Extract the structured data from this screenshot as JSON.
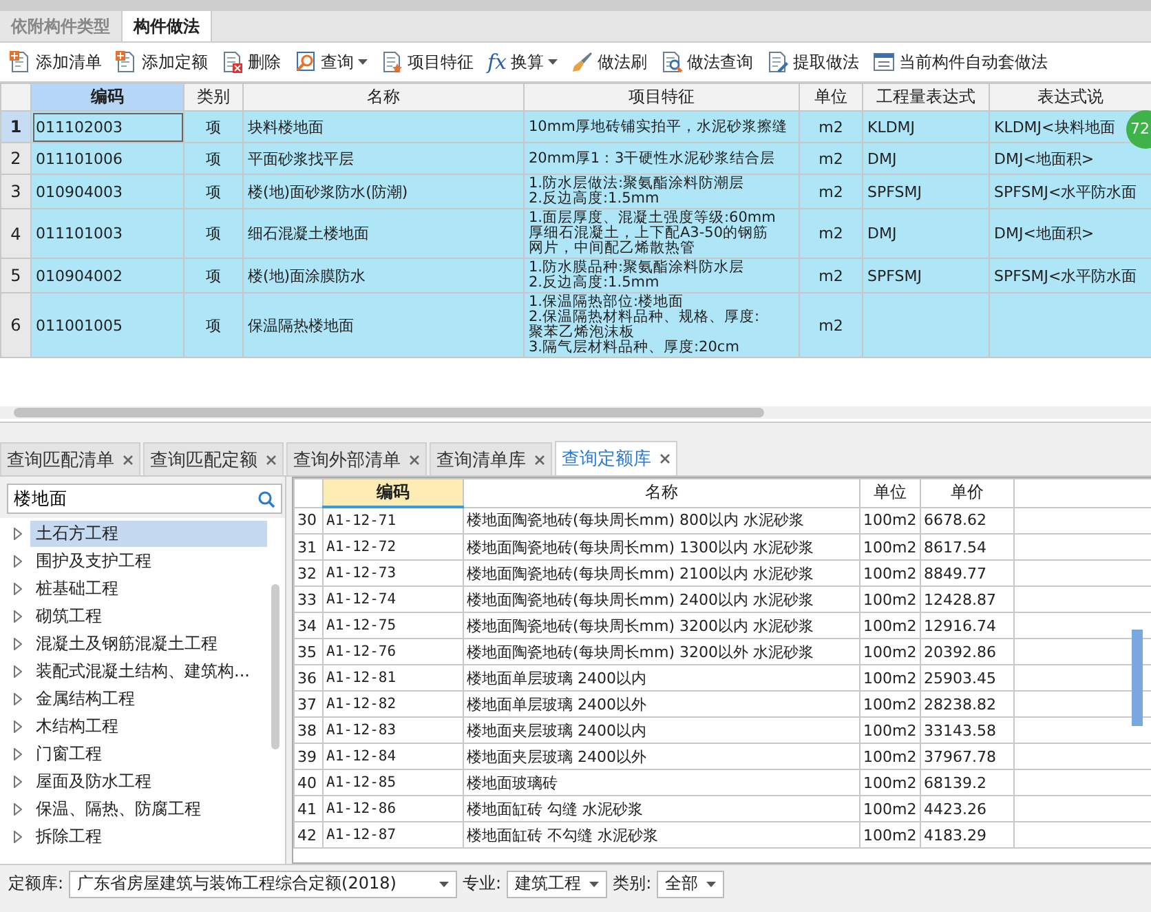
{
  "top_tabs": [
    {
      "label": "依附构件类型",
      "selected": false
    },
    {
      "label": "构件做法",
      "selected": true
    }
  ],
  "toolbar": [
    {
      "label": "添加清单",
      "dropdown": false
    },
    {
      "label": "添加定额",
      "dropdown": false
    },
    {
      "label": "删除",
      "dropdown": false
    },
    {
      "label": "查询",
      "dropdown": true
    },
    {
      "label": "项目特征",
      "dropdown": false
    },
    {
      "label": "换算",
      "dropdown": true,
      "symbol": "fx"
    },
    {
      "label": "做法刷",
      "dropdown": false
    },
    {
      "label": "做法查询",
      "dropdown": false
    },
    {
      "label": "提取做法",
      "dropdown": false
    },
    {
      "label": "当前构件自动套做法",
      "dropdown": false
    }
  ],
  "upper_table": {
    "columns": [
      {
        "label": "编码",
        "selected": true
      },
      {
        "label": "类别",
        "selected": false
      },
      {
        "label": "名称",
        "selected": false
      },
      {
        "label": "项目特征",
        "selected": false
      },
      {
        "label": "单位",
        "selected": false
      },
      {
        "label": "工程量表达式",
        "selected": false
      },
      {
        "label": "表达式说",
        "selected": false
      }
    ],
    "rows": [
      {
        "number": "1",
        "selected": true,
        "code": "011102003",
        "type": "项",
        "name": "块料楼地面",
        "features": [
          "10mm厚地砖铺实拍平，水泥砂浆擦缝"
        ],
        "unit": "m2",
        "expression": "KLDMJ",
        "description": "KLDMJ<块料地面"
      },
      {
        "number": "2",
        "selected": false,
        "code": "011101006",
        "type": "项",
        "name": "平面砂浆找平层",
        "features": [
          "20mm厚1：3干硬性水泥砂浆结合层"
        ],
        "unit": "m2",
        "expression": "DMJ",
        "description": "DMJ<地面积>"
      },
      {
        "number": "3",
        "selected": false,
        "code": "010904003",
        "type": "项",
        "name": "楼(地)面砂浆防水(防潮)",
        "features": [
          "1.防水层做法:聚氨酯涂料防潮层",
          "2.反边高度:1.5mm"
        ],
        "unit": "m2",
        "expression": "SPFSMJ",
        "description": "SPFSMJ<水平防水面"
      },
      {
        "number": "4",
        "selected": false,
        "code": "011101003",
        "type": "项",
        "name": "细石混凝土楼地面",
        "features": [
          "1.面层厚度、混凝土强度等级:60mm",
          "厚细石混凝土，上下配A3-50的钢筋",
          "网片，中间配乙烯散热管"
        ],
        "unit": "m2",
        "expression": "DMJ",
        "description": "DMJ<地面积>"
      },
      {
        "number": "5",
        "selected": false,
        "code": "010904002",
        "type": "项",
        "name": "楼(地)面涂膜防水",
        "features": [
          "1.防水膜品种:聚氨酯涂料防水层",
          "2.反边高度:1.5mm"
        ],
        "unit": "m2",
        "expression": "SPFSMJ",
        "description": "SPFSMJ<水平防水面"
      },
      {
        "number": "6",
        "selected": false,
        "code": "011001005",
        "type": "项",
        "name": "保温隔热楼地面",
        "features": [
          "1.保温隔热部位:楼地面",
          "2.保温隔热材料品种、规格、厚度:",
          "聚苯乙烯泡沫板",
          "3.隔气层材料品种、厚度:20cm"
        ],
        "unit": "m2"
      }
    ]
  },
  "badge": "72",
  "bottom_tabs": [
    {
      "label": "查询匹配清单",
      "selected": false
    },
    {
      "label": "查询匹配定额",
      "selected": false
    },
    {
      "label": "查询外部清单",
      "selected": false
    },
    {
      "label": "查询清单库",
      "selected": false
    },
    {
      "label": "查询定额库",
      "selected": true
    }
  ],
  "search": {
    "value": "楼地面"
  },
  "tree": [
    {
      "label": "土石方工程",
      "selected": true
    },
    {
      "label": "围护及支护工程",
      "selected": false
    },
    {
      "label": "桩基础工程",
      "selected": false
    },
    {
      "label": "砌筑工程",
      "selected": false
    },
    {
      "label": "混凝土及钢筋混凝土工程",
      "selected": false
    },
    {
      "label": "装配式混凝土结构、建筑构...",
      "selected": false
    },
    {
      "label": "金属结构工程",
      "selected": false
    },
    {
      "label": "木结构工程",
      "selected": false
    },
    {
      "label": "门窗工程",
      "selected": false
    },
    {
      "label": "屋面及防水工程",
      "selected": false
    },
    {
      "label": "保温、隔热、防腐工程",
      "selected": false
    },
    {
      "label": "拆除工程",
      "selected": false
    }
  ],
  "quota_table": {
    "columns": [
      {
        "label": "编码",
        "selected": true
      },
      {
        "label": "名称",
        "selected": false
      },
      {
        "label": "单位",
        "selected": false
      },
      {
        "label": "单价",
        "selected": false
      }
    ],
    "rows": [
      {
        "number": "30",
        "cells": [
          "A1-12-71",
          "楼地面陶瓷地砖(每块周长mm) 800以内 水泥砂浆",
          "100m2",
          "6678.62"
        ]
      },
      {
        "number": "31",
        "cells": [
          "A1-12-72",
          "楼地面陶瓷地砖(每块周长mm) 1300以内 水泥砂浆",
          "100m2",
          "8617.54"
        ]
      },
      {
        "number": "32",
        "cells": [
          "A1-12-73",
          "楼地面陶瓷地砖(每块周长mm) 2100以内 水泥砂浆",
          "100m2",
          "8849.77"
        ]
      },
      {
        "number": "33",
        "cells": [
          "A1-12-74",
          "楼地面陶瓷地砖(每块周长mm) 2400以内 水泥砂浆",
          "100m2",
          "12428.87"
        ]
      },
      {
        "number": "34",
        "cells": [
          "A1-12-75",
          "楼地面陶瓷地砖(每块周长mm) 3200以内 水泥砂浆",
          "100m2",
          "12916.74"
        ]
      },
      {
        "number": "35",
        "cells": [
          "A1-12-76",
          "楼地面陶瓷地砖(每块周长mm) 3200以外 水泥砂浆",
          "100m2",
          "20392.86"
        ]
      },
      {
        "number": "36",
        "cells": [
          "A1-12-81",
          "楼地面单层玻璃 2400以内",
          "100m2",
          "25903.45"
        ]
      },
      {
        "number": "37",
        "cells": [
          "A1-12-82",
          "楼地面单层玻璃 2400以外",
          "100m2",
          "28238.82"
        ]
      },
      {
        "number": "38",
        "cells": [
          "A1-12-83",
          "楼地面夹层玻璃 2400以内",
          "100m2",
          "33143.58"
        ]
      },
      {
        "number": "39",
        "cells": [
          "A1-12-84",
          "楼地面夹层玻璃 2400以外",
          "100m2",
          "37967.78"
        ]
      },
      {
        "number": "40",
        "cells": [
          "A1-12-85",
          "楼地面玻璃砖",
          "100m2",
          "68139.2"
        ]
      },
      {
        "number": "41",
        "cells": [
          "A1-12-86",
          "楼地面缸砖 勾缝 水泥砂浆",
          "100m2",
          "4423.26"
        ]
      },
      {
        "number": "42",
        "cells": [
          "A1-12-87",
          "楼地面缸砖 不勾缝 水泥砂浆",
          "100m2",
          "4183.29"
        ]
      }
    ]
  },
  "footer": {
    "library_label": "定额库:",
    "library": "广东省房屋建筑与装饰工程综合定额(2018)",
    "specialty_label": "专业:",
    "specialty": "建筑工程",
    "category_label": "类别:",
    "category": "全部"
  }
}
